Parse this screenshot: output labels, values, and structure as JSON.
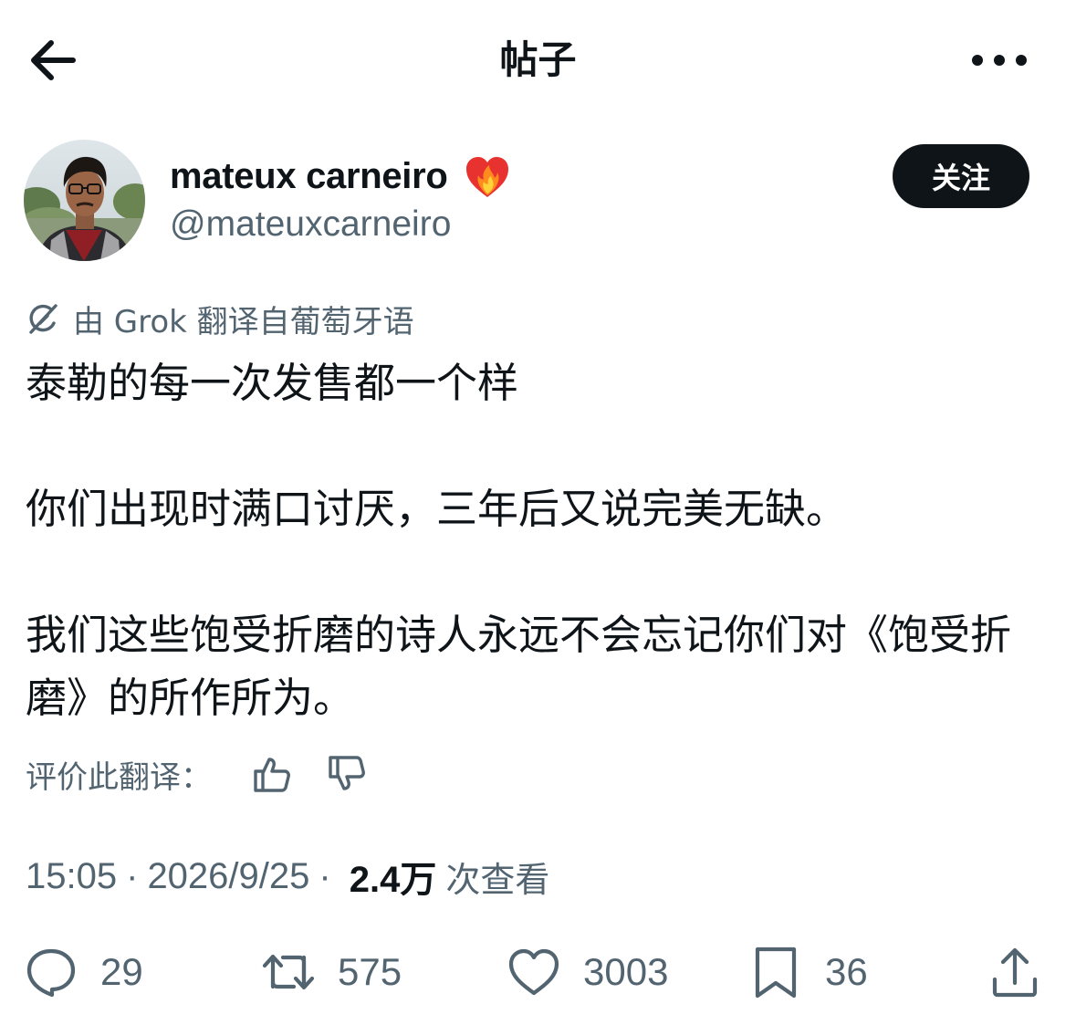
{
  "header": {
    "title": "帖子",
    "back_icon": "arrow-left-icon",
    "more_icon": "more-horizontal-icon"
  },
  "author": {
    "display_name": "mateux carneiro",
    "handle": "@mateuxcarneiro",
    "badge_icon": "heart-on-fire-icon",
    "follow_label": "关注"
  },
  "translation": {
    "icon": "grok-icon",
    "note": "由 Grok 翻译自葡萄牙语",
    "rate_label": "评价此翻译："
  },
  "post": {
    "paragraphs": [
      "泰勒的每一次发售都一个样",
      "你们出现时满口讨厌，三年后又说完美无缺。",
      "我们这些饱受折磨的诗人永远不会忘记你们对《饱受折磨》的所作所为。"
    ],
    "time": "15:05",
    "date": "2026/9/25",
    "separator": "·",
    "views_count": "2.4万",
    "views_label": "次查看"
  },
  "actions": {
    "reply": {
      "icon": "reply-icon",
      "count": "29"
    },
    "repost": {
      "icon": "repost-icon",
      "count": "575"
    },
    "like": {
      "icon": "heart-icon",
      "count": "3003"
    },
    "bookmark": {
      "icon": "bookmark-icon",
      "count": "36"
    },
    "share": {
      "icon": "share-icon"
    }
  },
  "colors": {
    "text_primary": "#0f1419",
    "text_secondary": "#536471",
    "follow_button_bg": "#0f1419",
    "follow_button_text": "#ffffff"
  }
}
